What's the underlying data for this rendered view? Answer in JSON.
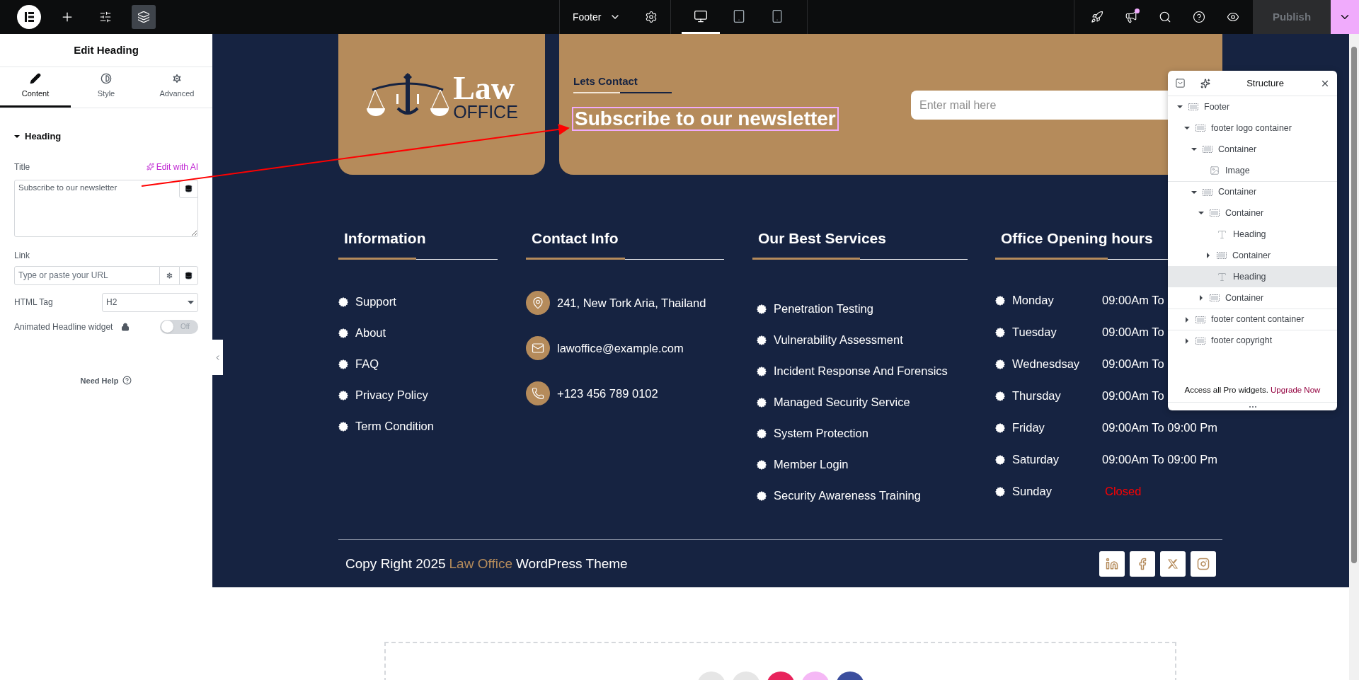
{
  "topbar": {
    "document": "Footer",
    "devices": [
      {
        "kind": "desktop",
        "selected": true
      },
      {
        "kind": "tablet",
        "selected": false
      },
      {
        "kind": "mobile",
        "selected": false
      }
    ],
    "notification": true,
    "publish": "Publish"
  },
  "panel": {
    "title": "Edit Heading",
    "tabs": [
      {
        "kind": "content",
        "label": "Content",
        "selected": true
      },
      {
        "kind": "style",
        "label": "Style",
        "selected": false
      },
      {
        "kind": "advanced",
        "label": "Advanced",
        "selected": false
      }
    ],
    "section": {
      "title": "Heading",
      "expanded": true
    },
    "title_label": "Title",
    "ai_link": "Edit with AI",
    "title_value": "Subscribe to our newsletter",
    "link_label": "Link",
    "link_placeholder": "Type or paste your URL",
    "tag_label": "HTML Tag",
    "tag_value": "H2",
    "animated_label": "Animated Headline widget",
    "animated": {
      "on": false,
      "label": "Off"
    },
    "help": "Need Help"
  },
  "footer": {
    "logo": {
      "word": "Law",
      "subword": "OFFICE"
    },
    "newsletter": {
      "eyebrow": "Lets Contact",
      "heading": "Subscribe to our newsletter",
      "heading_selected": true,
      "placeholder": "Enter mail here"
    },
    "information": {
      "title": "Information",
      "items": [
        "Support",
        "About",
        "FAQ",
        "Privacy Policy",
        "Term Condition"
      ]
    },
    "contact": {
      "title": "Contact Info",
      "items": [
        {
          "kind": "location",
          "text": "241, New Tork Aria, Thailand"
        },
        {
          "kind": "email",
          "text": "lawoffice@example.com"
        },
        {
          "kind": "phone",
          "text": "+123 456 789 0102"
        }
      ]
    },
    "services": {
      "title": "Our Best Services",
      "items": [
        "Penetration Testing",
        "Vulnerability Assessment",
        "Incident Response And Forensics",
        "Managed Security Service",
        "System Protection",
        "Member Login",
        "Security Awareness Training"
      ]
    },
    "hours": {
      "title": "Office Opening hours",
      "rows": [
        {
          "day": "Monday",
          "time": "09:00Am To",
          "closed": false
        },
        {
          "day": "Tuesday",
          "time": "09:00Am To",
          "closed": false
        },
        {
          "day": "Wednesdsay",
          "time": "09:00Am To",
          "closed": false
        },
        {
          "day": "Thursday",
          "time": "09:00Am To",
          "closed": false
        },
        {
          "day": "Friday",
          "time": "09:00Am To 09:00 Pm",
          "closed": false
        },
        {
          "day": "Saturday",
          "time": "09:00Am To 09:00 Pm",
          "closed": false
        },
        {
          "day": "Sunday",
          "time": "Closed",
          "closed": true
        }
      ]
    },
    "copyright": {
      "prefix": "Copy Right 2025",
      "brand": "Law Office",
      "suffix": "WordPress Theme"
    },
    "social": [
      {
        "kind": "linkedin"
      },
      {
        "kind": "facebook"
      },
      {
        "kind": "x"
      },
      {
        "kind": "instagram"
      }
    ]
  },
  "add_section": [
    {
      "color": "#e6e6e6"
    },
    {
      "color": "#e6e6e6"
    },
    {
      "color": "#e8245c"
    },
    {
      "color": "#f5b8f5"
    },
    {
      "color": "#3c4f9e"
    }
  ],
  "structure": {
    "title": "Structure",
    "tree": [
      {
        "label": "Footer",
        "kind": "container",
        "expanded": true,
        "selected": false,
        "children": [
          {
            "label": "footer logo container",
            "kind": "container",
            "expanded": true,
            "selected": false,
            "children": [
              {
                "label": "Container",
                "kind": "container",
                "expanded": true,
                "selected": false,
                "children": [
                  {
                    "label": "Image",
                    "kind": "image",
                    "selected": false
                  }
                ]
              },
              {
                "label": "Container",
                "kind": "container",
                "expanded": true,
                "selected": false,
                "children": [
                  {
                    "label": "Container",
                    "kind": "container",
                    "expanded": true,
                    "selected": false,
                    "children": [
                      {
                        "label": "Heading",
                        "kind": "heading",
                        "selected": false
                      },
                      {
                        "label": "Container",
                        "kind": "container",
                        "expanded": false,
                        "selected": false
                      },
                      {
                        "label": "Heading",
                        "kind": "heading",
                        "selected": true
                      }
                    ]
                  },
                  {
                    "label": "Container",
                    "kind": "container",
                    "expanded": false,
                    "selected": false
                  }
                ]
              }
            ]
          },
          {
            "label": "footer content container",
            "kind": "container",
            "expanded": false,
            "selected": false
          },
          {
            "label": "footer copyright",
            "kind": "container",
            "expanded": false,
            "selected": false
          }
        ]
      }
    ],
    "promo": "Access all Pro widgets.",
    "upgrade": "Upgrade Now"
  }
}
